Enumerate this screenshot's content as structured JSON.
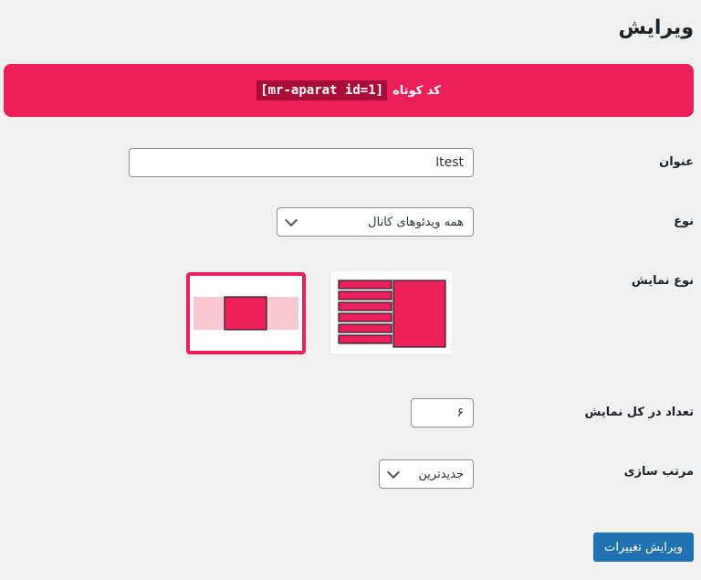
{
  "page": {
    "title": "ویرایش"
  },
  "shortcode": {
    "label": "کد کوتاه",
    "code": "[mr-aparat id=1]"
  },
  "form": {
    "title_label": "عنوان",
    "title_value": "test‌ا",
    "type_label": "نوع",
    "type_value": "همه ویدئوهای کانال",
    "display_label": "نوع نمایش",
    "display_options": [
      {
        "name": "slider",
        "selected": true
      },
      {
        "name": "list-with-featured",
        "selected": false
      }
    ],
    "count_label": "تعداد در کل نمایش",
    "count_value": "۶",
    "sort_label": "مرتب سازی",
    "sort_value": "جدیدترین"
  },
  "actions": {
    "submit_label": "ویرایش تغییرات"
  },
  "colors": {
    "accent": "#eb1f5a",
    "accent_light": "#f8c8d3",
    "button": "#2271b1"
  }
}
